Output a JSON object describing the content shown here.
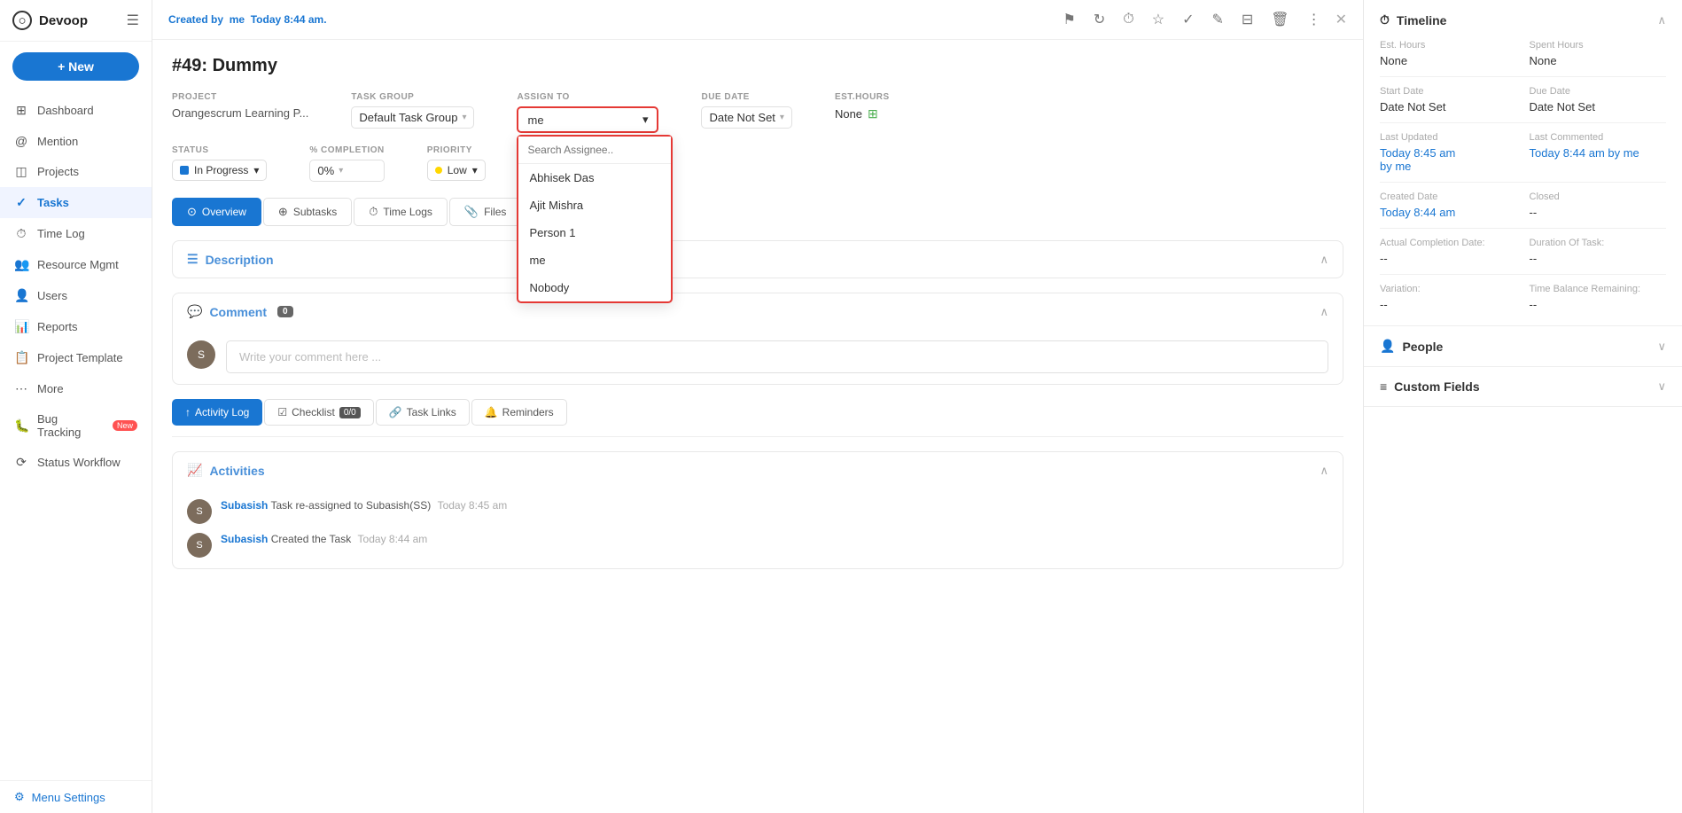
{
  "app": {
    "name": "Devoop"
  },
  "sidebar": {
    "new_button": "+ New",
    "items": [
      {
        "id": "dashboard",
        "label": "Dashboard",
        "icon": "⊞"
      },
      {
        "id": "mention",
        "label": "Mention",
        "icon": "@"
      },
      {
        "id": "projects",
        "label": "Projects",
        "icon": "◫"
      },
      {
        "id": "tasks",
        "label": "Tasks",
        "icon": "✓",
        "active": true
      },
      {
        "id": "timelog",
        "label": "Time Log",
        "icon": "⏱"
      },
      {
        "id": "resource",
        "label": "Resource Mgmt",
        "icon": "👥"
      },
      {
        "id": "users",
        "label": "Users",
        "icon": "👤"
      },
      {
        "id": "reports",
        "label": "Reports",
        "icon": "📊"
      },
      {
        "id": "project-template",
        "label": "Project Template",
        "icon": "📋"
      },
      {
        "id": "more",
        "label": "More",
        "icon": "⋯"
      },
      {
        "id": "bug-tracking",
        "label": "Bug Tracking",
        "icon": "🐛",
        "badge": "New"
      },
      {
        "id": "status-workflow",
        "label": "Status Workflow",
        "icon": "⟳"
      }
    ],
    "menu_settings": "Menu Settings"
  },
  "header": {
    "created_by_prefix": "Created by",
    "created_by_user": "me",
    "created_time": "Today 8:44 am."
  },
  "task": {
    "title": "#49: Dummy",
    "project_label": "PROJECT",
    "project_value": "Orangescrum Learning P...",
    "task_group_label": "TASK GROUP",
    "task_group_value": "Default Task Group",
    "assign_to_label": "ASSIGN TO",
    "assign_to_value": "me",
    "due_date_label": "DUE DATE",
    "due_date_value": "Date Not Set",
    "est_hours_label": "EST.HOURS",
    "est_hours_value": "None",
    "status_label": "STATUS",
    "status_value": "In Progress",
    "completion_label": "% COMPLETION",
    "completion_value": "0%",
    "priority_label": "PRIORITY",
    "priority_value": "Low"
  },
  "assignee_dropdown": {
    "search_placeholder": "Search Assignee..",
    "options": [
      {
        "label": "Abhisek Das"
      },
      {
        "label": "Ajit Mishra"
      },
      {
        "label": "Person 1"
      },
      {
        "label": "me"
      },
      {
        "label": "Nobody"
      }
    ]
  },
  "tabs": [
    {
      "id": "overview",
      "label": "Overview",
      "icon": "⊙",
      "active": true
    },
    {
      "id": "subtasks",
      "label": "Subtasks",
      "icon": "⊕"
    },
    {
      "id": "timelogs",
      "label": "Time Logs",
      "icon": "⏱"
    },
    {
      "id": "files",
      "label": "Files",
      "icon": "📎"
    }
  ],
  "description": {
    "title": "Description"
  },
  "comment": {
    "title": "Comment",
    "count": "0",
    "placeholder": "Write your comment here ..."
  },
  "bottom_tabs": [
    {
      "id": "activity-log",
      "label": "Activity Log",
      "active": true
    },
    {
      "id": "checklist",
      "label": "Checklist",
      "count": "0/0"
    },
    {
      "id": "task-links",
      "label": "Task Links"
    },
    {
      "id": "reminders",
      "label": "Reminders"
    }
  ],
  "activities": {
    "title": "Activities",
    "items": [
      {
        "user": "Subasish",
        "action": "Task re-assigned to Subasish(SS)",
        "time": "Today 8:45 am"
      },
      {
        "user": "Subasish",
        "action": "Created the Task",
        "time": "Today 8:44 am"
      }
    ]
  },
  "timeline": {
    "title": "Timeline",
    "fields": [
      {
        "label": "Est. Hours",
        "value": "None",
        "col": 1
      },
      {
        "label": "Spent Hours",
        "value": "None",
        "col": 2
      },
      {
        "label": "Start Date",
        "value": "Date Not Set",
        "col": 1
      },
      {
        "label": "Due Date",
        "value": "Date Not Set",
        "col": 2
      },
      {
        "label": "Last Updated",
        "value": "Today 8:45 am\nby me",
        "col": 1,
        "blue": true
      },
      {
        "label": "Last Commented",
        "value": "Today 8:44 am by me",
        "col": 2,
        "blue": true
      },
      {
        "label": "Created Date",
        "value": "Today 8:44 am",
        "col": 1,
        "blue": true
      },
      {
        "label": "Closed",
        "value": "--",
        "col": 2
      },
      {
        "label": "Actual Completion Date:",
        "value": "--",
        "col": 1
      },
      {
        "label": "Duration Of Task:",
        "value": "--",
        "col": 2
      },
      {
        "label": "Variation:",
        "value": "--",
        "col": 1
      },
      {
        "label": "Time Balance Remaining:",
        "value": "--",
        "col": 2
      }
    ]
  },
  "people": {
    "title": "People"
  },
  "custom_fields": {
    "title": "Custom Fields"
  }
}
